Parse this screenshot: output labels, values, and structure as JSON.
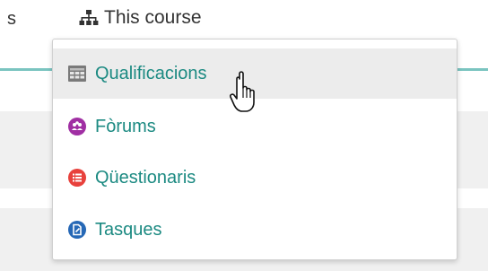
{
  "navbar": {
    "left_fragment": "s",
    "course_menu_label": "This course"
  },
  "dropdown": {
    "items": [
      {
        "label": "Qualificacions",
        "icon": "grades-table-icon",
        "color": "#777777",
        "highlighted": true
      },
      {
        "label": "Fòrums",
        "icon": "forum-icon",
        "color": "#a02fa3",
        "highlighted": false
      },
      {
        "label": "Qüestionaris",
        "icon": "quiz-icon",
        "color": "#e8413c",
        "highlighted": false
      },
      {
        "label": "Tasques",
        "icon": "assignment-icon",
        "color": "#2668b6",
        "highlighted": false
      }
    ]
  },
  "colors": {
    "link": "#1c8a82",
    "accent_line": "#7ac4c0",
    "highlight": "#ececec"
  }
}
